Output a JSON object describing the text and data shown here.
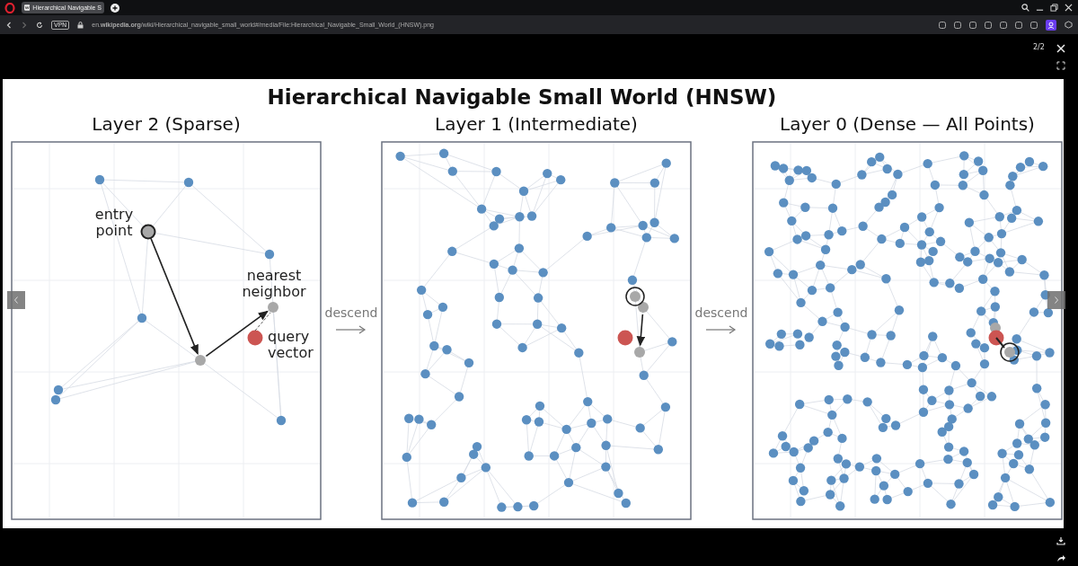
{
  "browser": {
    "tabs": [
      {
        "title": "Hierarchical Navigable S",
        "selected": true
      }
    ],
    "address": "en.**wikipedia.org**/wiki/Hierarchical_navigable_small_world#/media/File:Hierarchical_Navigable_Small_World_(HNSW).png",
    "vpn_badge": "VPN"
  },
  "viewer": {
    "counter": "2/2"
  },
  "figure": {
    "title": "Hierarchical Navigable Small World (HNSW)",
    "panels": [
      {
        "kind": "sparse",
        "title": "Layer 2 (Sparse)",
        "annotations": [
          {
            "kind": "entry",
            "lines": [
              "entry",
              "point"
            ]
          },
          {
            "kind": "nearest",
            "lines": [
              "nearest",
              "neighbor"
            ]
          },
          {
            "kind": "query",
            "lines": [
              "query",
              "vector"
            ]
          }
        ]
      },
      {
        "kind": "intermediate",
        "title": "Layer 1 (Intermediate)"
      },
      {
        "kind": "dense",
        "title": "Layer 0 (Dense — All Points)"
      }
    ],
    "transitions": [
      "descend",
      "descend"
    ]
  }
}
